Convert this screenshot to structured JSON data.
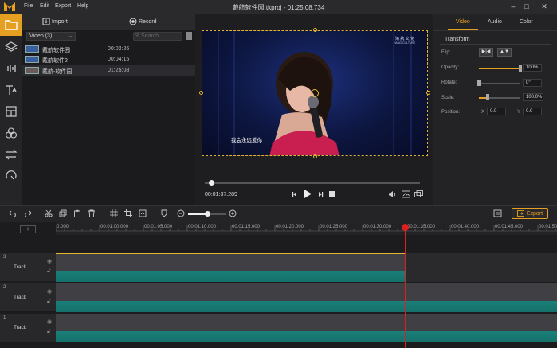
{
  "window": {
    "title": "戴航软件园.tkproj - 01:25:08.734",
    "menu": [
      "File",
      "Edit",
      "Export",
      "Help"
    ]
  },
  "media": {
    "import_label": "Import",
    "record_label": "Record",
    "filter_value": "Video (3)",
    "search_placeholder": "Search",
    "files": [
      {
        "name": "戴航软件园",
        "duration": "00:02:26"
      },
      {
        "name": "戴航软件2",
        "duration": "00:04:15"
      },
      {
        "name": "戴航-软件园",
        "duration": "01:25:08"
      }
    ]
  },
  "preview": {
    "timecode": "00:01:37.289",
    "progress": 0.02,
    "subtitle": "我会永远爱你",
    "watermark_line1": "鴻 航 文 化",
    "watermark_line2": "HANG CULTURE"
  },
  "properties": {
    "tabs": [
      "Video",
      "Audio",
      "Color"
    ],
    "section": "Transform",
    "flip_label": "Flip:",
    "opacity_label": "Opacity:",
    "opacity_value": "100%",
    "opacity_level": 1.0,
    "rotate_label": "Rotate:",
    "rotate_value": "0°",
    "rotate_level": 0.0,
    "scale_label": "Scale:",
    "scale_value": "100.0%",
    "scale_level": 0.22,
    "position_label": "Position:",
    "x_label": "X",
    "x_value": "0.0",
    "y_label": "Y",
    "y_value": "0.0"
  },
  "toolbar": {
    "export_label": "Export",
    "zoom_level": 0.5
  },
  "timeline": {
    "ticks": [
      "0.000",
      "00:01:00.000",
      "00:01:05.000",
      "00:01:10.000",
      "00:01:15.000",
      "00:01:20.000",
      "00:01:25.000",
      "00:01:30.000",
      "00:01:35.000",
      "00:01:40.000",
      "00:01:45.000",
      "00:01:50.000"
    ],
    "tracks": [
      {
        "number": "3",
        "label": "Track"
      },
      {
        "number": "2",
        "label": "Track"
      },
      {
        "number": "1",
        "label": "Track"
      }
    ]
  },
  "colors": {
    "accent": "#e59f21",
    "playhead": "#e02020",
    "audio_wave": "#1a7f7a"
  }
}
